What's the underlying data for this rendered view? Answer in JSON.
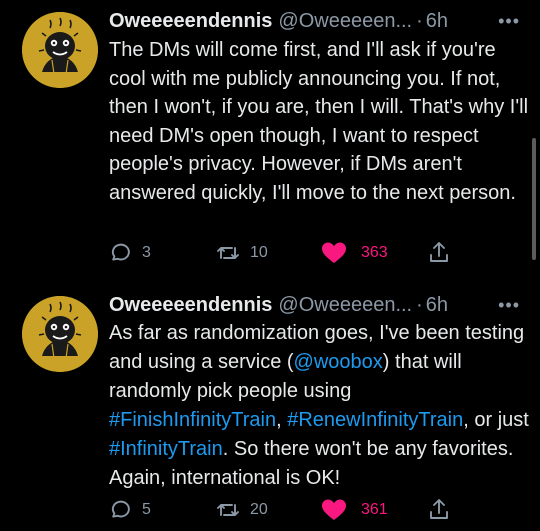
{
  "colors": {
    "background": "#000000",
    "text": "#e7e9ea",
    "muted": "#8b98a5",
    "link": "#1d9bf0",
    "like": "#f91880",
    "avatar_bg": "#c9a227"
  },
  "tweets": [
    {
      "name": "Oweeeeendennis",
      "handle": "@Oweeeeen...",
      "dot": "·",
      "time": "6h",
      "more": "•••",
      "avatar_icon": "avatar-icon",
      "text_segments": [
        {
          "text": "The DMs will come first, and I'll ask if you're cool with me publicly announcing you. If not, then I won't, if you are, then I will. That's why I'll need DM's open though, I want to respect people's privacy. However, if DMs aren't answered quickly, I'll move to the next person.",
          "link": false
        }
      ],
      "replies": "3",
      "retweets": "10",
      "likes": "363",
      "liked": true
    },
    {
      "name": "Oweeeeendennis",
      "handle": "@Oweeeeen...",
      "dot": "·",
      "time": "6h",
      "more": "•••",
      "avatar_icon": "avatar-icon",
      "text_segments": [
        {
          "text": "As far as randomization goes, I've been testing and using a service (",
          "link": false
        },
        {
          "text": "@woobox",
          "link": true
        },
        {
          "text": ") that will randomly pick people using ",
          "link": false
        },
        {
          "text": "#FinishInfinityTrain",
          "link": true
        },
        {
          "text": ", ",
          "link": false
        },
        {
          "text": "#RenewInfinityTrain",
          "link": true
        },
        {
          "text": ", or just ",
          "link": false
        },
        {
          "text": "#InfinityTrain",
          "link": true
        },
        {
          "text": ". So there won't be any favorites. Again, international is OK!",
          "link": false
        }
      ],
      "replies": "5",
      "retweets": "20",
      "likes": "361",
      "liked": true
    }
  ]
}
